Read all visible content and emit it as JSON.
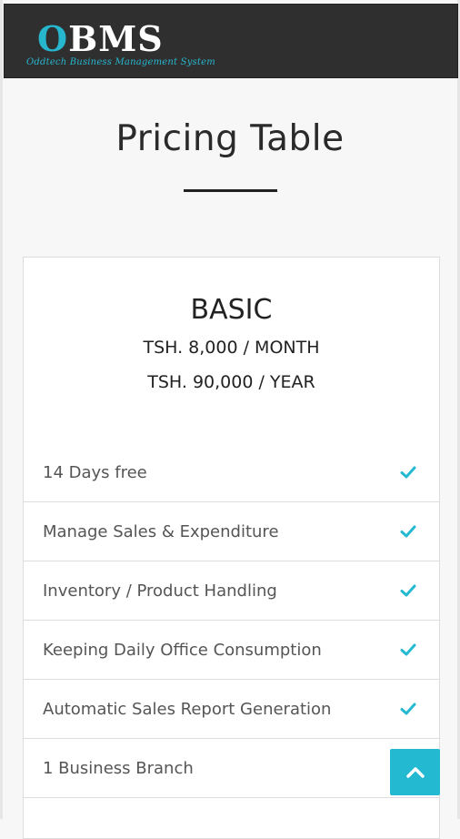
{
  "header": {
    "logo_text_first": "O",
    "logo_text_rest": "BMS",
    "logo_tagline": "Oddtech Business Management System"
  },
  "page": {
    "title": "Pricing Table"
  },
  "plan": {
    "name": "BASIC",
    "price_month": "TSH. 8,000 / MONTH",
    "price_year": "TSH. 90,000 / YEAR",
    "features": [
      {
        "label": "14 Days free",
        "check": true
      },
      {
        "label": "Manage Sales & Expenditure",
        "check": true
      },
      {
        "label": "Inventory / Product Handling",
        "check": true
      },
      {
        "label": "Keeping Daily Office Consumption",
        "check": true
      },
      {
        "label": "Automatic Sales Report Generation",
        "check": true
      },
      {
        "label": "1 Business Branch",
        "check": false
      }
    ]
  },
  "colors": {
    "accent": "#23b9d1",
    "header_bg": "#2f2f2f"
  },
  "icons": {
    "check": "check-icon",
    "scroll_top": "chevron-up-icon"
  }
}
